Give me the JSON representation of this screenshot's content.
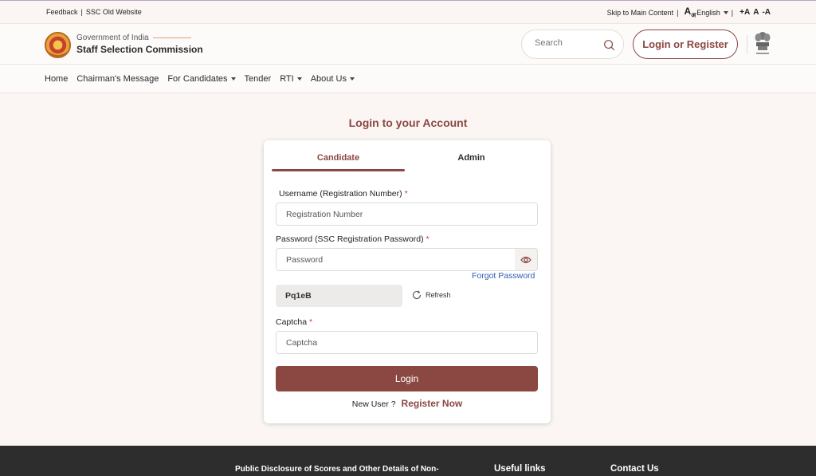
{
  "topbar": {
    "feedback": "Feedback",
    "old_site": "SSC Old Website",
    "skip": "Skip to Main Content",
    "lang_glyph": "A",
    "lang_glyph_sub": "अ",
    "language": "English",
    "font_increase": "+A",
    "font_normal": "A",
    "font_decrease": "-A"
  },
  "header": {
    "brand_sub": "Government of India",
    "brand_title": "Staff Selection Commission",
    "search_placeholder": "Search",
    "login_register": "Login or Register",
    "accent_color": "#8b4742"
  },
  "nav": {
    "items": [
      {
        "label": "Home",
        "dropdown": false
      },
      {
        "label": "Chairman's Message",
        "dropdown": false
      },
      {
        "label": "For Candidates",
        "dropdown": true
      },
      {
        "label": "Tender",
        "dropdown": false
      },
      {
        "label": "RTI",
        "dropdown": true
      },
      {
        "label": "About Us",
        "dropdown": true
      }
    ]
  },
  "login": {
    "heading": "Login to your Account",
    "tabs": [
      "Candidate",
      "Admin"
    ],
    "active_tab": "Candidate",
    "username_label": "Username (Registration Number)",
    "username_placeholder": "Registration Number",
    "password_label": "Password (SSC Registration Password)",
    "password_placeholder": "Password",
    "forgot": "Forgot Password",
    "captcha_text": "Pq1eB",
    "refresh": "Refresh",
    "captcha_label": "Captcha",
    "captcha_placeholder": "Captcha",
    "login_button": "Login",
    "new_user": "New User ?",
    "register_now": "Register Now",
    "required_mark": "*"
  },
  "footer": {
    "col1": "Public Disclosure of Scores and Other Details of Non-",
    "col2": "Useful links",
    "col3": "Contact Us"
  }
}
